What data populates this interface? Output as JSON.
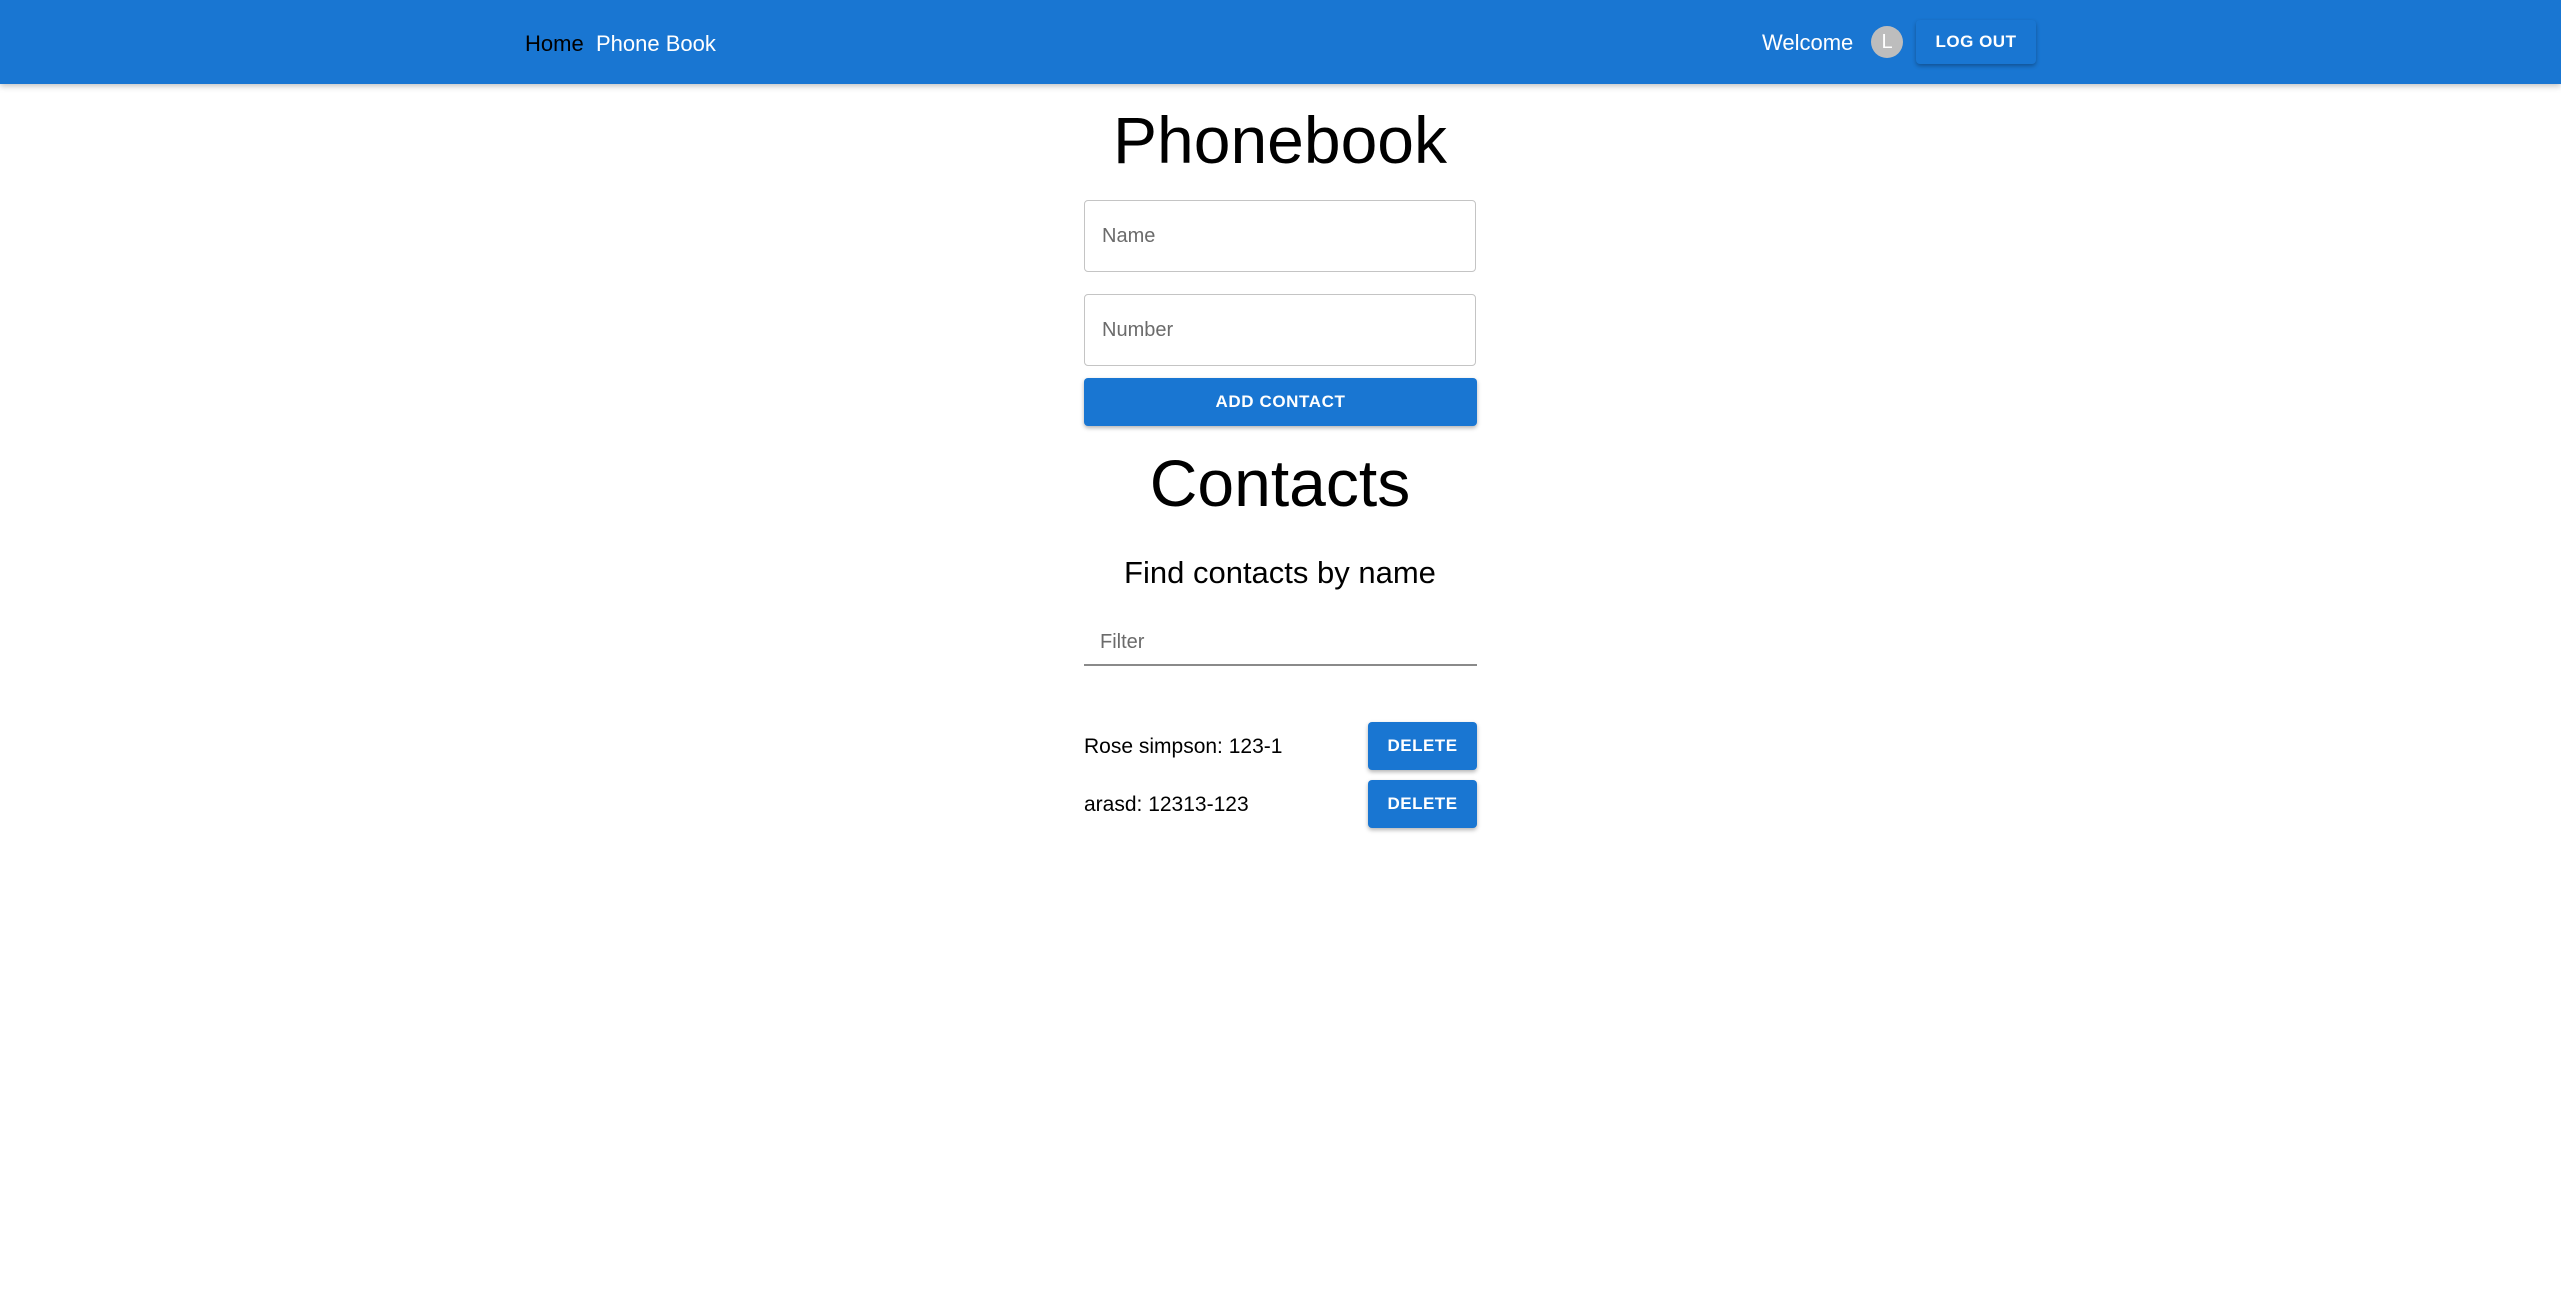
{
  "header": {
    "nav_home": "Home",
    "nav_phonebook": "Phone Book",
    "welcome": "Welcome",
    "avatar_letter": "L",
    "logout_label": "LOG OUT"
  },
  "main": {
    "title": "Phonebook",
    "name_placeholder": "Name",
    "number_placeholder": "Number",
    "add_label": "ADD CONTACT",
    "contacts_title": "Contacts",
    "find_heading": "Find contacts by name",
    "filter_placeholder": "Filter"
  },
  "contacts": [
    {
      "text": "Rose simpson: 123-1",
      "delete_label": "DELETE"
    },
    {
      "text": "arasd: 12313-123",
      "delete_label": "DELETE"
    }
  ],
  "colors": {
    "primary": "#1976d2",
    "avatar_bg": "#bdbdbd"
  }
}
